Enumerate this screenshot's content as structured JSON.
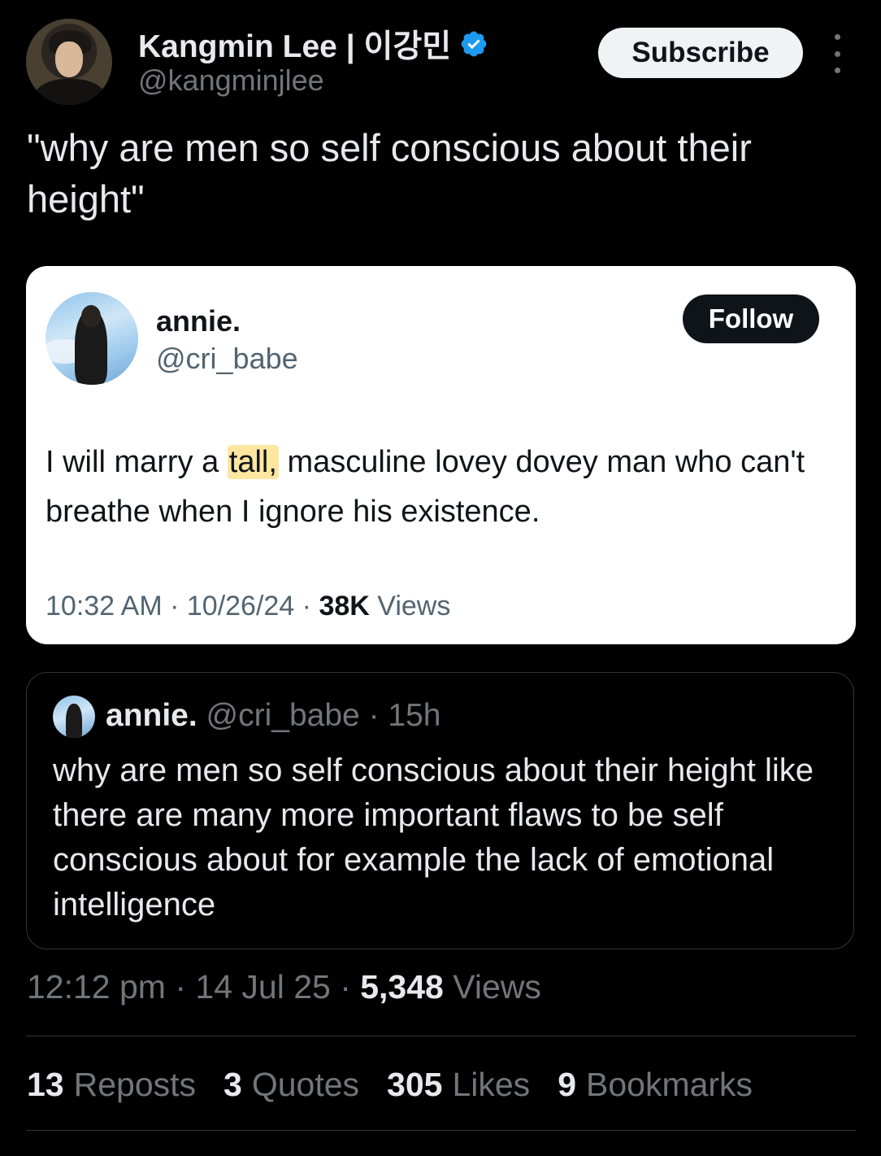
{
  "author": {
    "name": "Kangmin Lee | 이강민",
    "handle": "@kangminjlee",
    "verified": true,
    "subscribe_label": "Subscribe"
  },
  "tweet_text": "\"why are men so self conscious about their height\"",
  "screenshot_card": {
    "name": "annie.",
    "handle": "@cri_babe",
    "follow_label": "Follow",
    "text_before": "I will marry a ",
    "text_highlight": "tall,",
    "text_after": " masculine lovey dovey man who can't breathe when I ignore his existence.",
    "time": "10:32 AM",
    "date": "10/26/24",
    "views_count": "38K",
    "views_label": "Views",
    "highlight_color": "#fde7a0"
  },
  "quoted_tweet": {
    "name": "annie.",
    "handle": "@cri_babe",
    "age": "15h",
    "text": "why are men so self conscious about their height like there are many more important flaws to be self conscious about for example the lack of emotional intelligence"
  },
  "meta": {
    "time": "12:12 pm",
    "date": "14 Jul 25",
    "views_count": "5,348",
    "views_label": "Views"
  },
  "stats": [
    {
      "count": "13",
      "label": "Reposts"
    },
    {
      "count": "3",
      "label": "Quotes"
    },
    {
      "count": "305",
      "label": "Likes"
    },
    {
      "count": "9",
      "label": "Bookmarks"
    }
  ],
  "colors": {
    "background": "#000000",
    "verified_blue": "#1d9bf0",
    "muted_text": "#71767b"
  },
  "icons": [
    "verified-badge-icon",
    "more-options-icon"
  ]
}
